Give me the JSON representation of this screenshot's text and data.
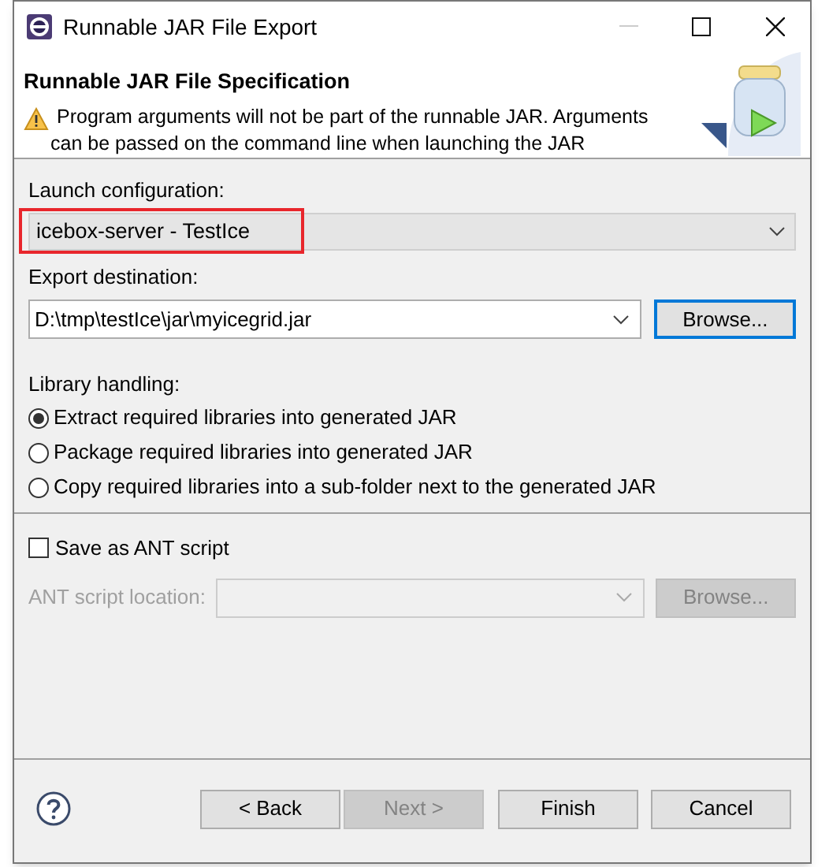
{
  "window": {
    "title": "Runnable JAR File Export"
  },
  "header": {
    "title": "Runnable JAR File Specification",
    "message": "Program arguments will not be part of the runnable JAR. Arguments can be passed on the command line when launching the JAR"
  },
  "launch_configuration": {
    "label": "Launch configuration:",
    "value": "icebox-server - TestIce",
    "highlighted": true
  },
  "export_destination": {
    "label": "Export destination:",
    "value": "D:\\tmp\\testIce\\jar\\myicegrid.jar",
    "button": "Browse...",
    "button_focused": true
  },
  "library_handling": {
    "label": "Library handling:",
    "options": [
      {
        "label": "Extract required libraries into generated JAR",
        "selected": true
      },
      {
        "label": "Package required libraries into generated JAR",
        "selected": false
      },
      {
        "label": "Copy required libraries into a sub-folder next to the generated JAR",
        "selected": false
      }
    ]
  },
  "save_ant": {
    "label": "Save as ANT script",
    "checked": false
  },
  "ant_location": {
    "label": "ANT script location:",
    "button": "Browse...",
    "disabled": true
  },
  "buttons": [
    {
      "label": "< Back",
      "disabled": false
    },
    {
      "label": "Next >",
      "disabled": true
    },
    {
      "label": "Finish",
      "disabled": false
    },
    {
      "label": "Cancel",
      "disabled": false
    }
  ]
}
